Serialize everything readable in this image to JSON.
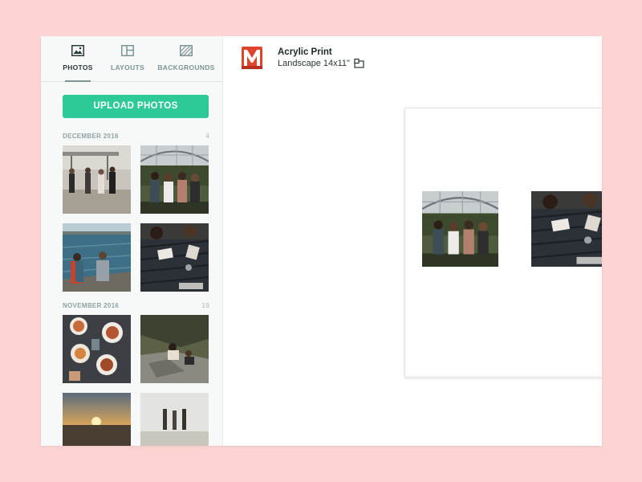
{
  "sidebar": {
    "tabs": [
      {
        "label": "PHOTOS",
        "icon": "image-icon",
        "active": true
      },
      {
        "label": "LAYOUTS",
        "icon": "layout-icon",
        "active": false
      },
      {
        "label": "BACKGROUNDS",
        "icon": "pattern-icon",
        "active": false
      }
    ],
    "upload_label": "UPLOAD PHOTOS",
    "sections": [
      {
        "title": "DECEMBER 2016",
        "count": "4"
      },
      {
        "title": "NOVEMBER 2016",
        "count": "19"
      }
    ]
  },
  "product": {
    "brand_icon": "mixbook-m-logo",
    "title": "Acrylic Print",
    "subtitle": "Landscape 14x11\"",
    "edit_icon": "resize-icon"
  },
  "colors": {
    "background": "#fdd4d4",
    "accent": "#2ec999",
    "brand": "#e0442c"
  }
}
